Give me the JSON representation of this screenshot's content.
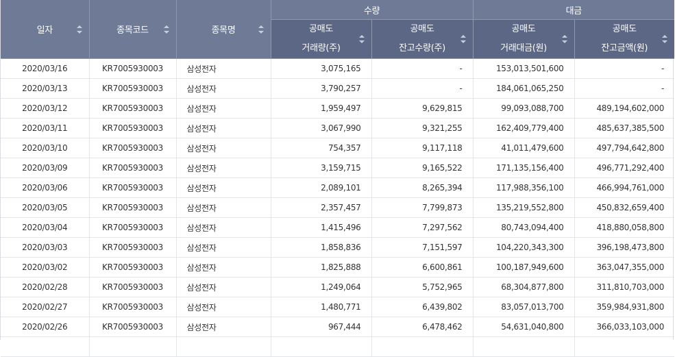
{
  "header": {
    "date": "일자",
    "code": "종목코드",
    "name": "종목명",
    "group_qty": "수량",
    "group_amt": "대금",
    "qty_trade_line1": "공매도",
    "qty_trade_line2": "거래량(주)",
    "qty_bal_line1": "공매도",
    "qty_bal_line2": "잔고수량(주)",
    "amt_trade_line1": "공매도",
    "amt_trade_line2": "거래대금(원)",
    "amt_bal_line1": "공매도",
    "amt_bal_line2": "잔고금액(원)"
  },
  "rows": [
    {
      "date": "2020/03/16",
      "code": "KR7005930003",
      "name": "삼성전자",
      "qty_trade": "3,075,165",
      "qty_bal": "-",
      "amt_trade": "153,013,501,600",
      "amt_bal": "-"
    },
    {
      "date": "2020/03/13",
      "code": "KR7005930003",
      "name": "삼성전자",
      "qty_trade": "3,790,257",
      "qty_bal": "-",
      "amt_trade": "184,061,065,250",
      "amt_bal": "-"
    },
    {
      "date": "2020/03/12",
      "code": "KR7005930003",
      "name": "삼성전자",
      "qty_trade": "1,959,497",
      "qty_bal": "9,629,815",
      "amt_trade": "99,093,088,700",
      "amt_bal": "489,194,602,000"
    },
    {
      "date": "2020/03/11",
      "code": "KR7005930003",
      "name": "삼성전자",
      "qty_trade": "3,067,990",
      "qty_bal": "9,321,255",
      "amt_trade": "162,409,779,400",
      "amt_bal": "485,637,385,500"
    },
    {
      "date": "2020/03/10",
      "code": "KR7005930003",
      "name": "삼성전자",
      "qty_trade": "754,357",
      "qty_bal": "9,117,118",
      "amt_trade": "41,011,479,600",
      "amt_bal": "497,794,642,800"
    },
    {
      "date": "2020/03/09",
      "code": "KR7005930003",
      "name": "삼성전자",
      "qty_trade": "3,159,715",
      "qty_bal": "9,165,522",
      "amt_trade": "171,135,156,400",
      "amt_bal": "496,771,292,400"
    },
    {
      "date": "2020/03/06",
      "code": "KR7005930003",
      "name": "삼성전자",
      "qty_trade": "2,089,101",
      "qty_bal": "8,265,394",
      "amt_trade": "117,988,356,100",
      "amt_bal": "466,994,761,000"
    },
    {
      "date": "2020/03/05",
      "code": "KR7005930003",
      "name": "삼성전자",
      "qty_trade": "2,357,457",
      "qty_bal": "7,799,873",
      "amt_trade": "135,219,552,800",
      "amt_bal": "450,832,659,400"
    },
    {
      "date": "2020/03/04",
      "code": "KR7005930003",
      "name": "삼성전자",
      "qty_trade": "1,415,496",
      "qty_bal": "7,297,562",
      "amt_trade": "80,743,094,400",
      "amt_bal": "418,880,058,800"
    },
    {
      "date": "2020/03/03",
      "code": "KR7005930003",
      "name": "삼성전자",
      "qty_trade": "1,858,836",
      "qty_bal": "7,151,597",
      "amt_trade": "104,220,343,300",
      "amt_bal": "396,198,473,800"
    },
    {
      "date": "2020/03/02",
      "code": "KR7005930003",
      "name": "삼성전자",
      "qty_trade": "1,825,888",
      "qty_bal": "6,600,861",
      "amt_trade": "100,187,949,600",
      "amt_bal": "363,047,355,000"
    },
    {
      "date": "2020/02/28",
      "code": "KR7005930003",
      "name": "삼성전자",
      "qty_trade": "1,249,064",
      "qty_bal": "5,752,965",
      "amt_trade": "68,304,877,800",
      "amt_bal": "311,810,703,000"
    },
    {
      "date": "2020/02/27",
      "code": "KR7005930003",
      "name": "삼성전자",
      "qty_trade": "1,480,771",
      "qty_bal": "6,439,802",
      "amt_trade": "83,057,013,700",
      "amt_bal": "359,984,931,800"
    },
    {
      "date": "2020/02/26",
      "code": "KR7005930003",
      "name": "삼성전자",
      "qty_trade": "967,444",
      "qty_bal": "6,478,462",
      "amt_trade": "54,631,040,800",
      "amt_bal": "366,033,103,000"
    },
    {
      "date": "",
      "code": "",
      "name": "",
      "qty_trade": "",
      "qty_bal": "",
      "amt_trade": "",
      "amt_bal": ""
    }
  ]
}
